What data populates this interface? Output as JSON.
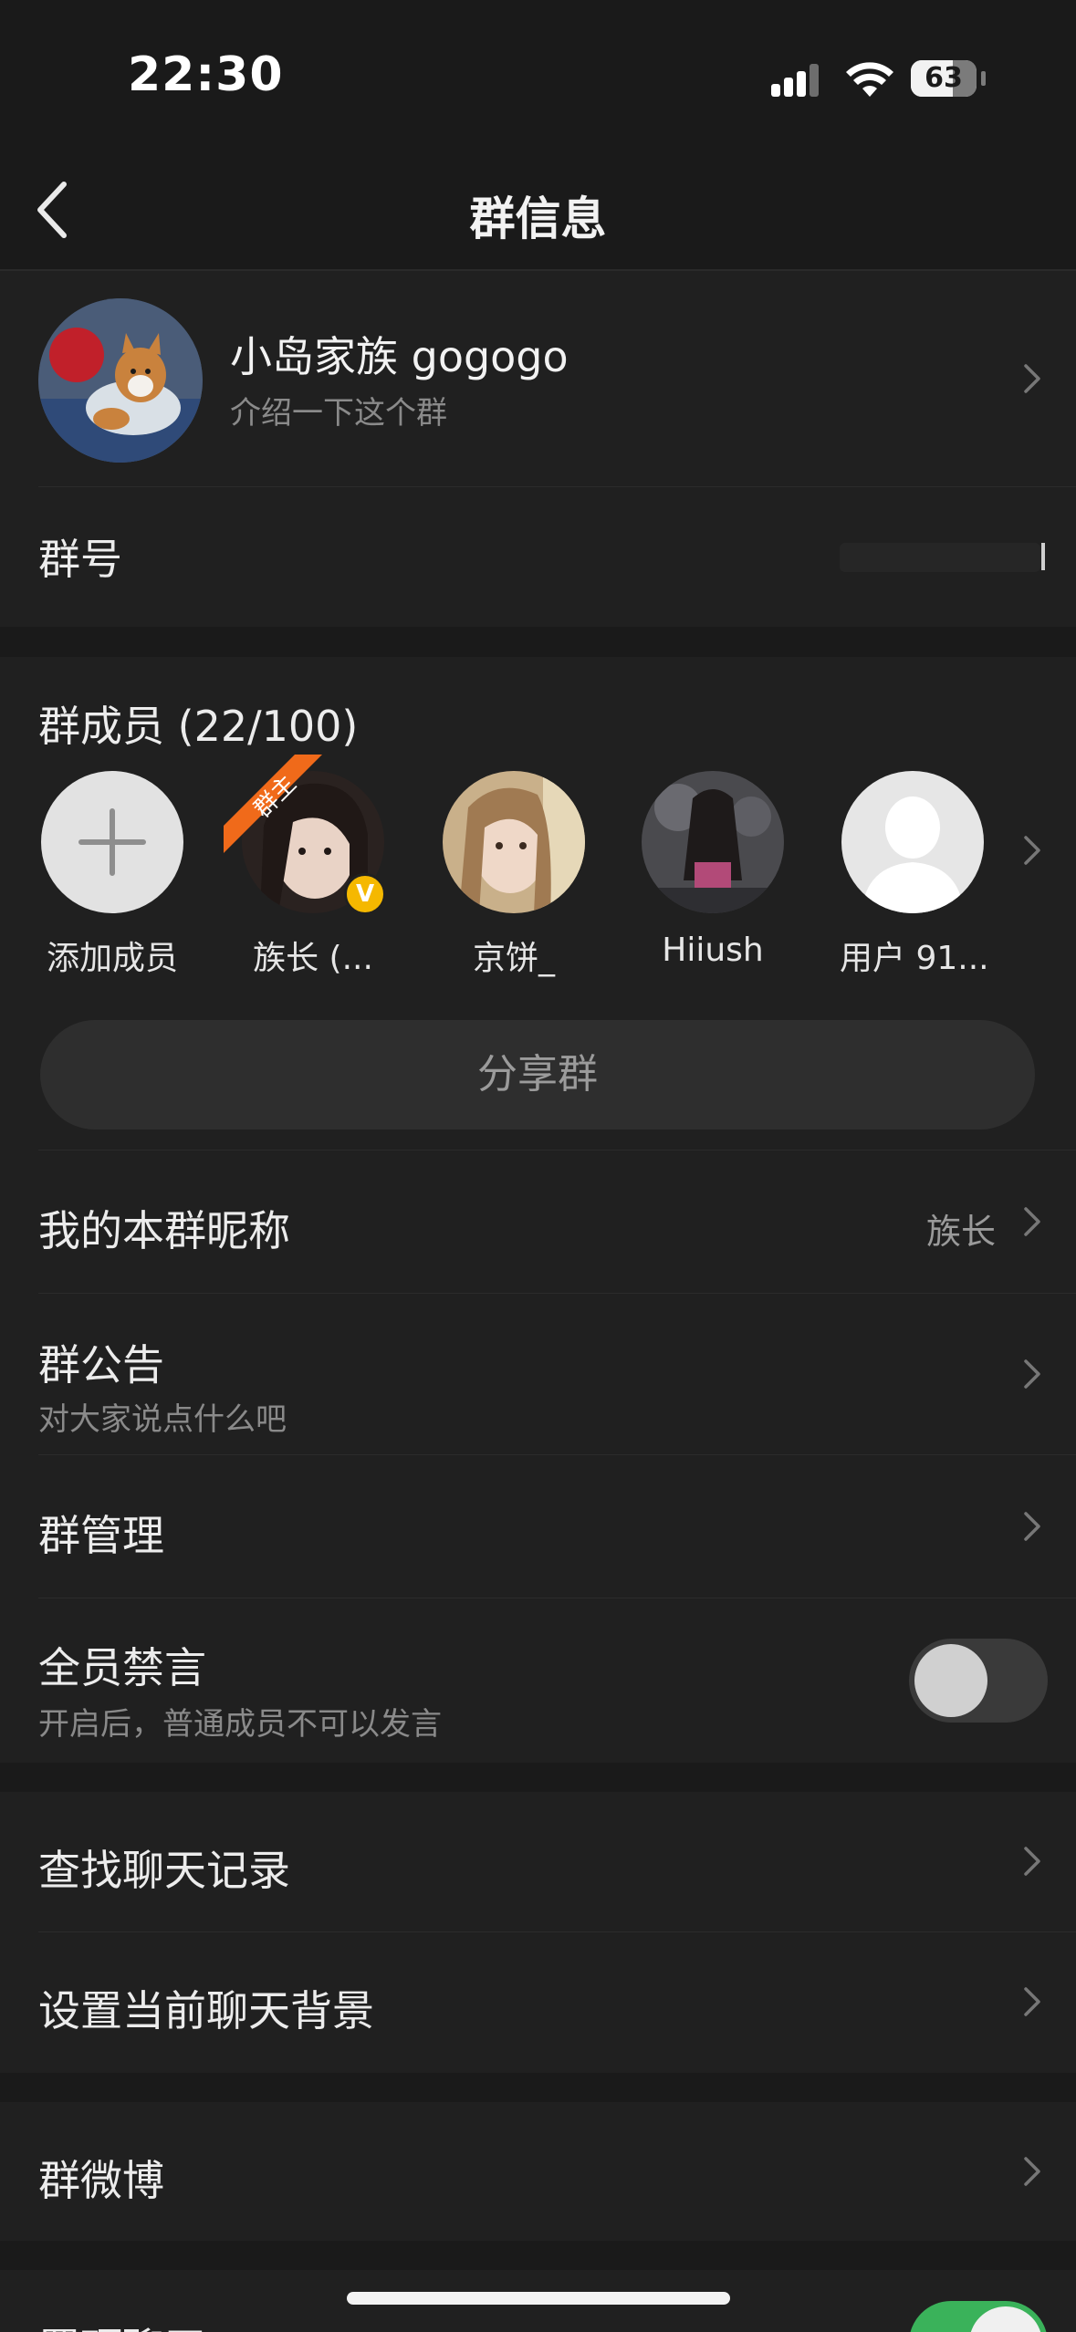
{
  "status_bar": {
    "time": "22:30",
    "battery": "63"
  },
  "nav": {
    "title": "群信息",
    "back_icon": "chevron-left-icon"
  },
  "group": {
    "name": "小岛家族 gogogo",
    "description": "介绍一下这个群"
  },
  "group_id": {
    "label": "群号",
    "value": ""
  },
  "members": {
    "title": "群成员 (22/100)",
    "items": [
      {
        "name": "添加成员",
        "kind": "add"
      },
      {
        "name": "族长 (...",
        "badge": "群主",
        "verified": "V"
      },
      {
        "name": "京饼_"
      },
      {
        "name": "Hiiush"
      },
      {
        "name": "用户 91..."
      }
    ]
  },
  "share_button": {
    "label": "分享群"
  },
  "nickname": {
    "label": "我的本群昵称",
    "value": "族长"
  },
  "announcement": {
    "label": "群公告",
    "subtitle": "对大家说点什么吧"
  },
  "management": {
    "label": "群管理"
  },
  "mute_all": {
    "label": "全员禁言",
    "subtitle": "开启后，普通成员不可以发言",
    "enabled": false
  },
  "search_history": {
    "label": "查找聊天记录"
  },
  "chat_background": {
    "label": "设置当前聊天背景"
  },
  "group_weibo": {
    "label": "群微博"
  },
  "pin_chat": {
    "label": "置顶聊天",
    "enabled": true
  },
  "colors": {
    "background": "#1a1a1a",
    "card": "#202020",
    "toggle_on": "#3ab25a",
    "badge": "#f06a1a",
    "verified": "#f5b800"
  }
}
